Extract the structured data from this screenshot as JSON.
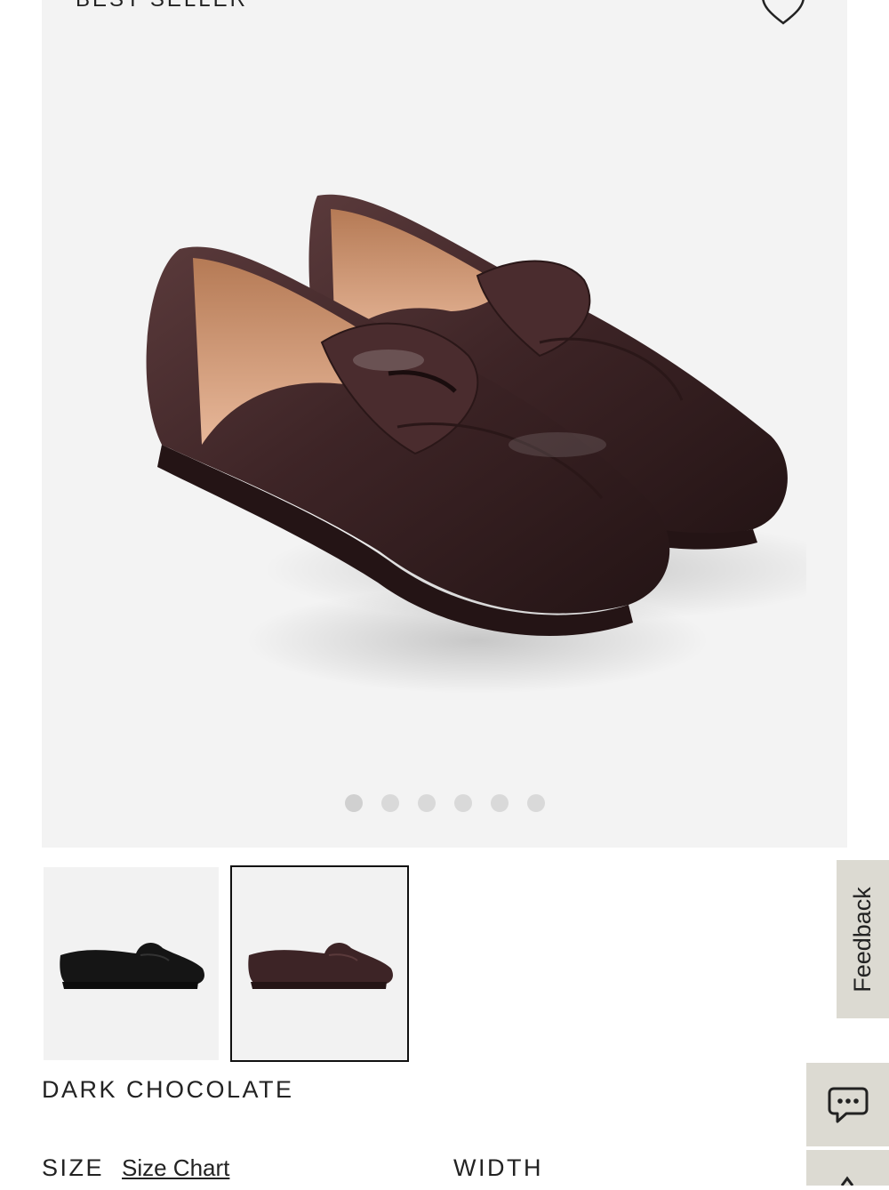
{
  "product": {
    "badge": "BEST SELLER",
    "selected_color": "DARK CHOCOLATE",
    "image_count": 6,
    "active_image_index": 0,
    "thumbnails": [
      {
        "name": "thumb-black",
        "color": "#1a1a1a"
      },
      {
        "name": "thumb-dark-chocolate",
        "color": "#3d2426",
        "selected": true
      }
    ]
  },
  "options": {
    "size_label": "SIZE",
    "size_chart_link": "Size Chart",
    "width_label": "WIDTH"
  },
  "side_widgets": {
    "feedback_label": "Feedback",
    "chat_icon": "chat-bubble-icon"
  },
  "colors": {
    "hero_bg": "#f3f3f3",
    "widget_bg": "#dcdad2",
    "shoe_dark_chocolate": "#3d2426",
    "shoe_black": "#1a1a1a"
  }
}
